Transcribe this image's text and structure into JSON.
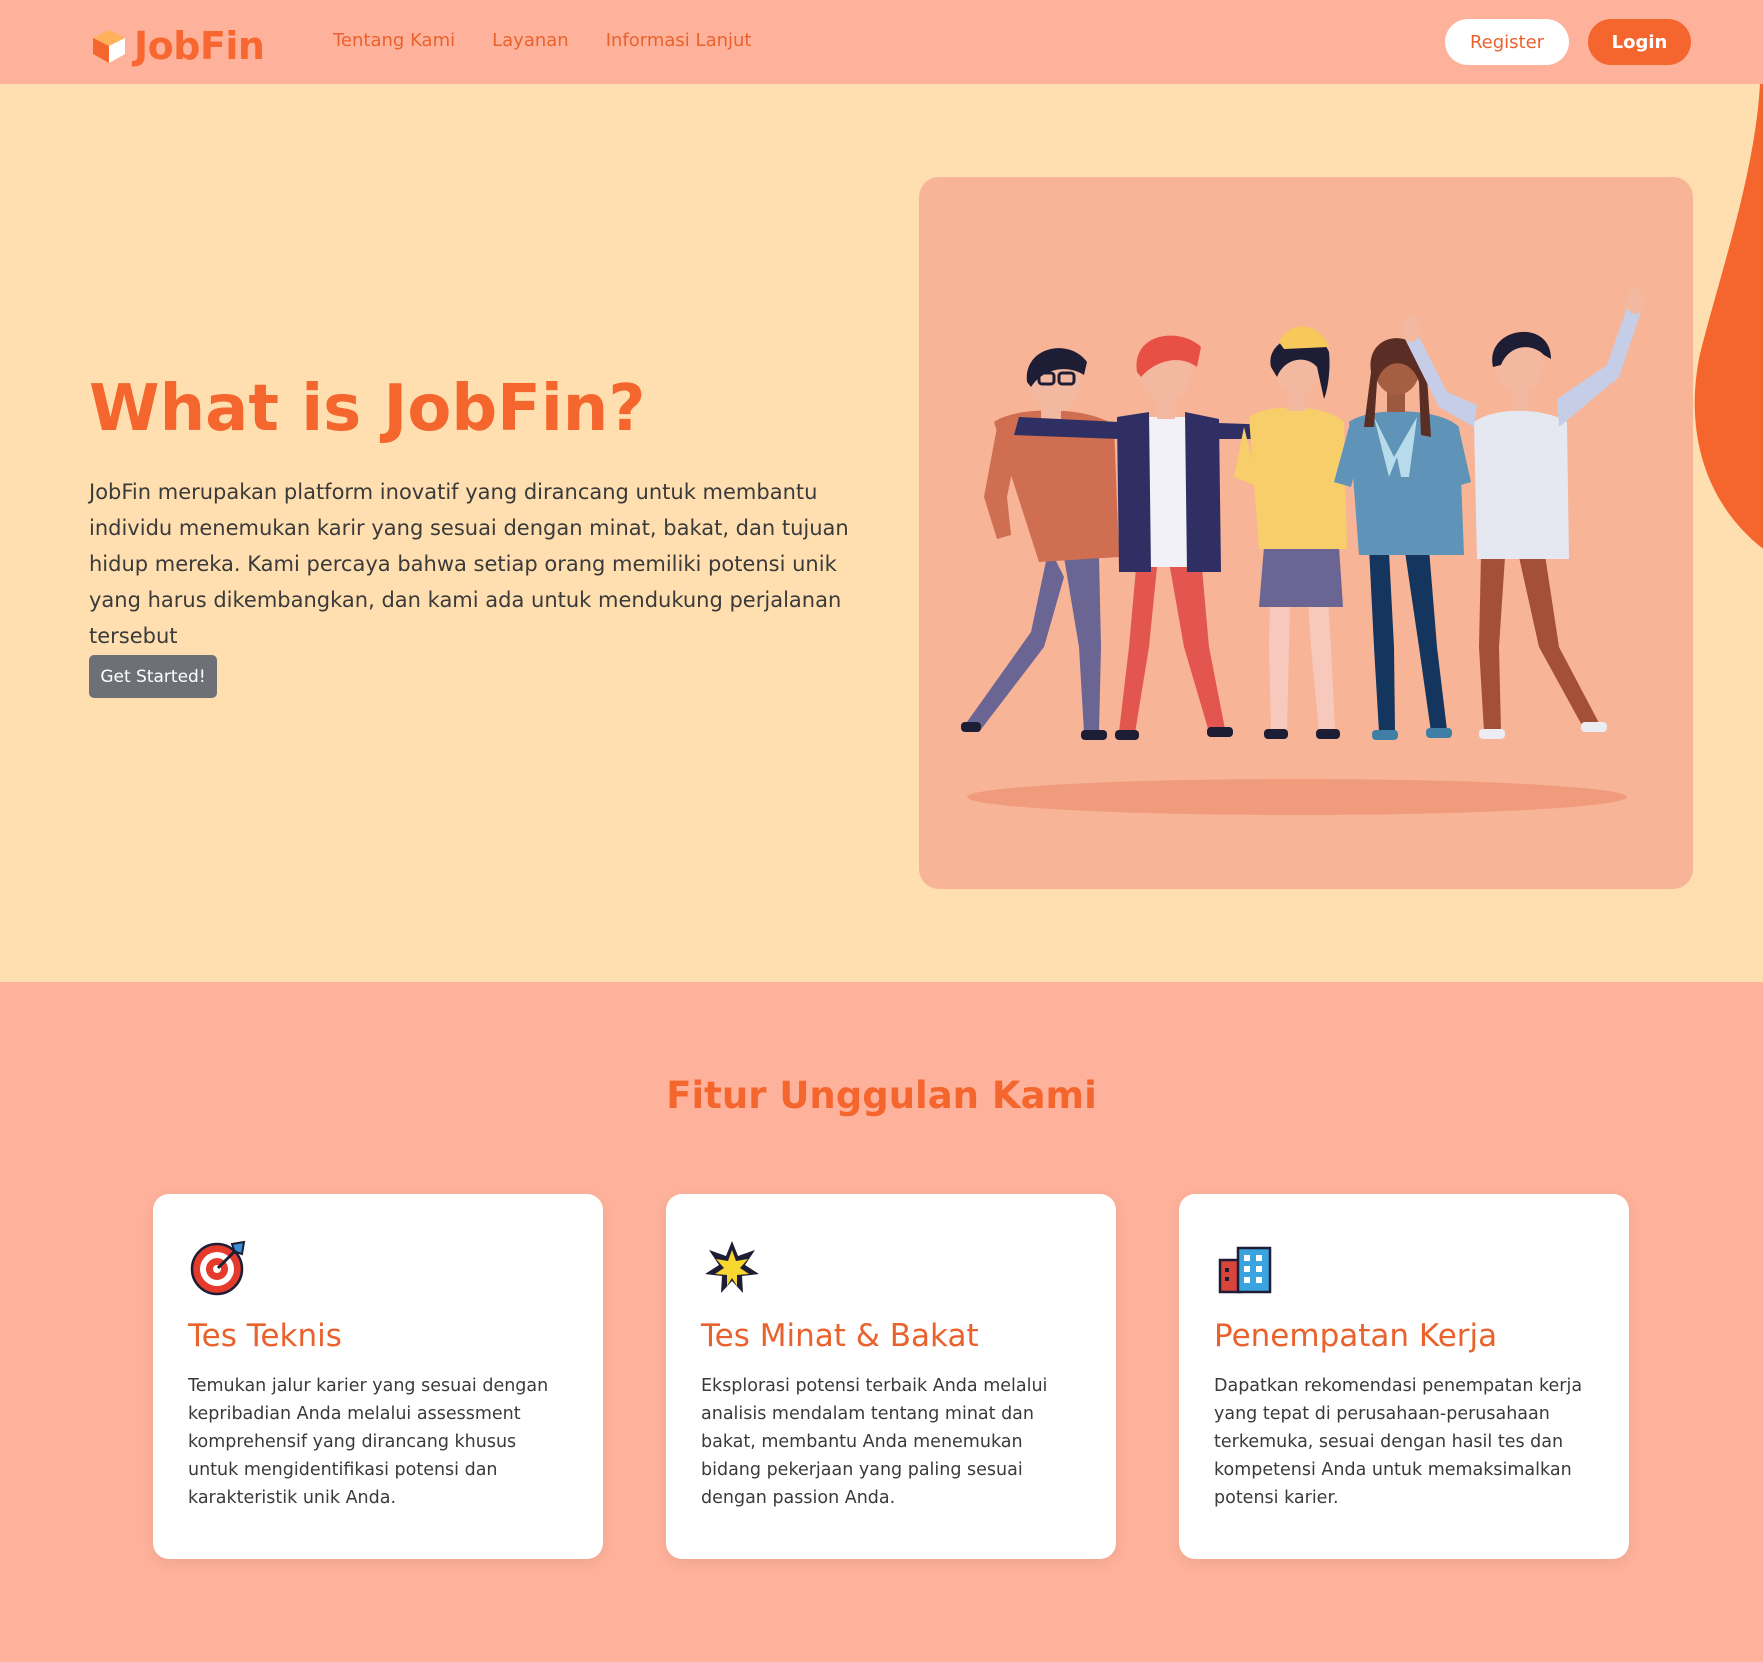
{
  "nav": {
    "logo_text": "JobFin",
    "links": [
      "Tentang Kami",
      "Layanan",
      "Informasi Lanjut"
    ],
    "register_label": "Register",
    "login_label": "Login"
  },
  "hero": {
    "title": "What is JobFin?",
    "description": "JobFin merupakan platform inovatif yang dirancang untuk membantu individu menemukan karir yang sesuai dengan minat, bakat, dan tujuan hidup mereka. Kami percaya bahwa setiap orang memiliki potensi unik yang harus dikembangkan, dan kami ada untuk mendukung perjalanan tersebut",
    "cta_label": "Get Started!"
  },
  "features": {
    "title": "Fitur Unggulan Kami",
    "cards": [
      {
        "icon": "target-icon",
        "title": "Tes Teknis",
        "description": "Temukan jalur karier yang sesuai dengan kepribadian Anda melalui assessment komprehensif yang dirancang khusus untuk mengidentifikasi potensi dan karakteristik unik Anda."
      },
      {
        "icon": "star-icon",
        "title": "Tes Minat & Bakat",
        "description": "Eksplorasi potensi terbaik Anda melalui analisis mendalam tentang minat dan bakat, membantu Anda menemukan bidang pekerjaan yang paling sesuai dengan passion Anda."
      },
      {
        "icon": "office-building-icon",
        "title": "Penempatan Kerja",
        "description": "Dapatkan rekomendasi penempatan kerja yang tepat di perusahaan-perusahaan terkemuka, sesuai dengan hasil tes dan kompetensi Anda untuk memaksimalkan potensi karier."
      }
    ]
  },
  "colors": {
    "brand_orange": "#f4662d",
    "nav_bg": "#ffb29b",
    "hero_bg": "#ffdfb0",
    "button_gray": "#6d7177"
  }
}
